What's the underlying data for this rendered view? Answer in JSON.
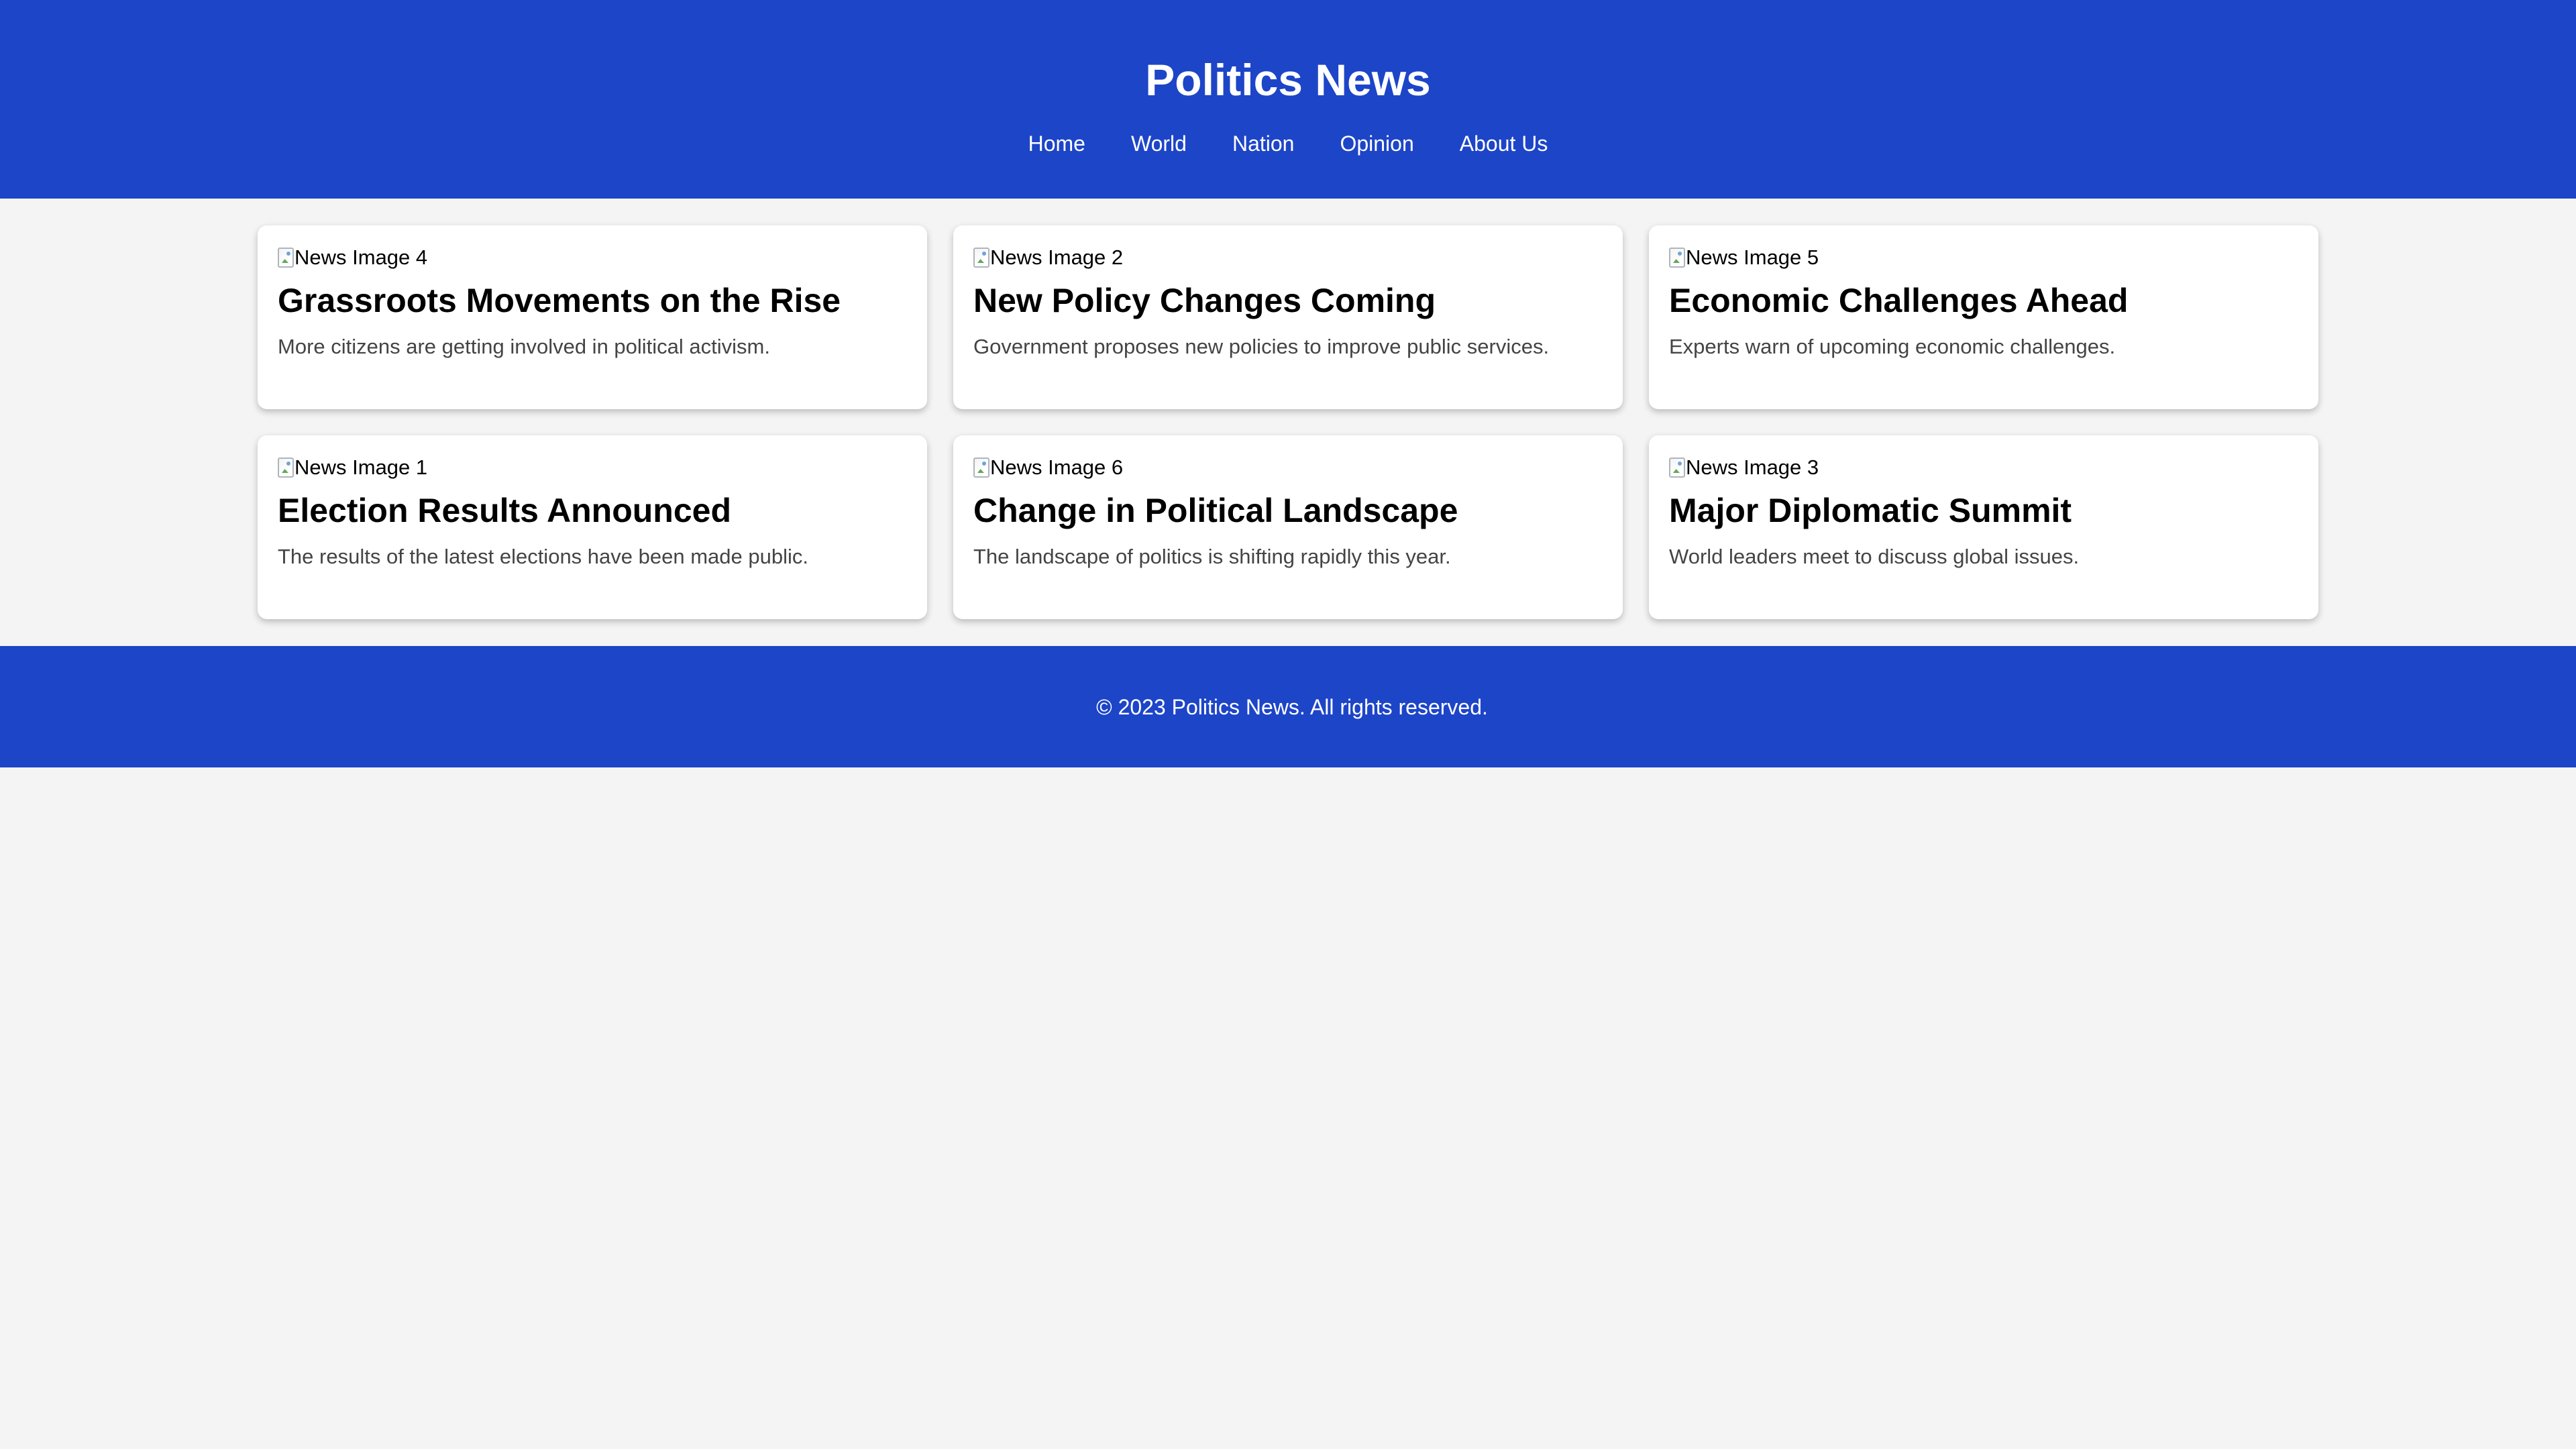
{
  "site": {
    "title": "Politics News"
  },
  "nav": {
    "items": [
      {
        "label": "Home"
      },
      {
        "label": "World"
      },
      {
        "label": "Nation"
      },
      {
        "label": "Opinion"
      },
      {
        "label": "About Us"
      }
    ]
  },
  "articles": [
    {
      "image_alt": "News Image 4",
      "title": "Grassroots Movements on the Rise",
      "summary": "More citizens are getting involved in political activism."
    },
    {
      "image_alt": "News Image 2",
      "title": "New Policy Changes Coming",
      "summary": "Government proposes new policies to improve public services."
    },
    {
      "image_alt": "News Image 5",
      "title": "Economic Challenges Ahead",
      "summary": "Experts warn of upcoming economic challenges."
    },
    {
      "image_alt": "News Image 1",
      "title": "Election Results Announced",
      "summary": "The results of the latest elections have been made public."
    },
    {
      "image_alt": "News Image 6",
      "title": "Change in Political Landscape",
      "summary": "The landscape of politics is shifting rapidly this year."
    },
    {
      "image_alt": "News Image 3",
      "title": "Major Diplomatic Summit",
      "summary": "World leaders meet to discuss global issues."
    }
  ],
  "footer": {
    "text": "© 2023 Politics News. All rights reserved."
  },
  "colors": {
    "header_background": "#1d45c8",
    "page_background": "#f4f4f4",
    "card_background": "#ffffff",
    "summary_text": "#444444"
  },
  "icons": {
    "image_placeholder": "broken-image-icon"
  }
}
